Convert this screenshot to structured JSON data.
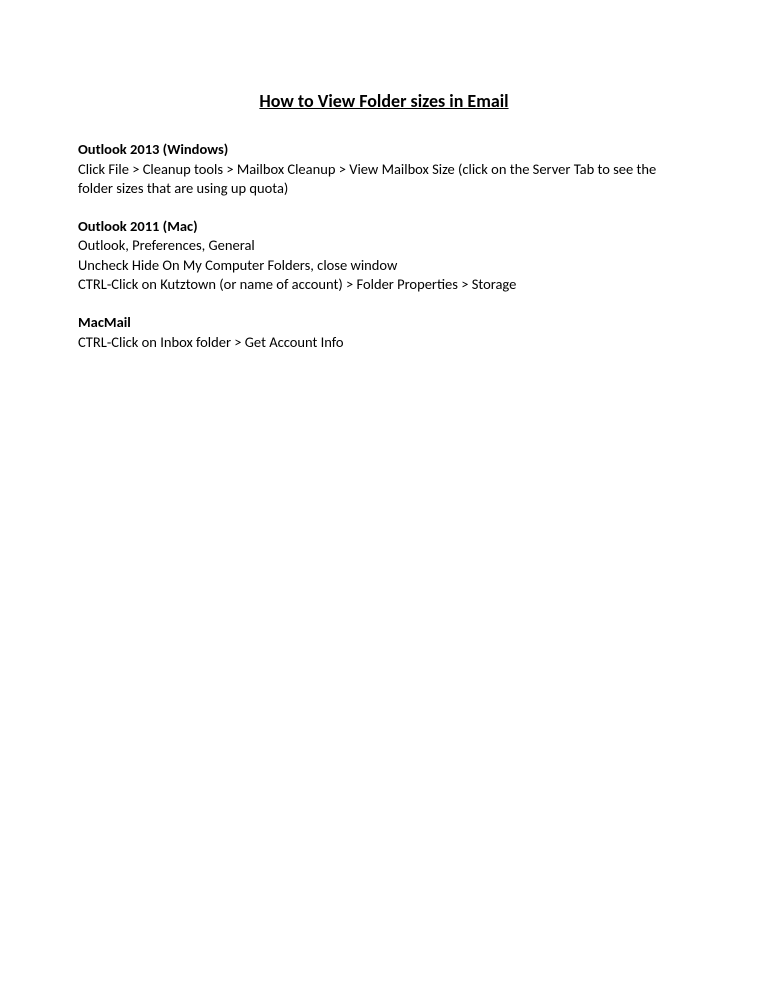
{
  "title": "How to View Folder sizes in Email",
  "sections": [
    {
      "heading": "Outlook 2013 (Windows)",
      "body": "Click File > Cleanup tools > Mailbox Cleanup > View Mailbox Size (click on the Server Tab to see the folder sizes that are using up quota)"
    },
    {
      "heading": "Outlook 2011 (Mac)",
      "body": "Outlook, Preferences, General\nUncheck Hide On My Computer Folders, close window\nCTRL-Click on Kutztown (or name of account) > Folder Properties > Storage"
    },
    {
      "heading": "MacMail",
      "body": "CTRL-Click on Inbox folder > Get Account Info"
    }
  ]
}
